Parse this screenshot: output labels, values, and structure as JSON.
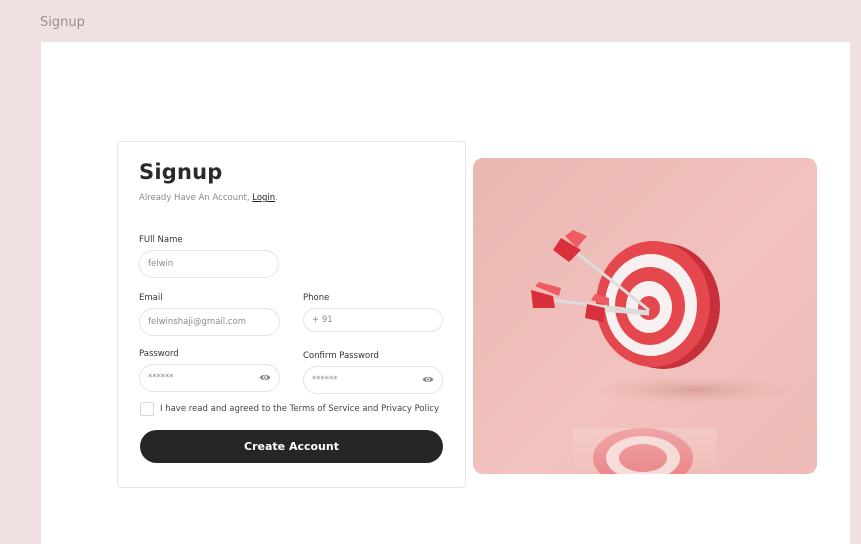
{
  "frame": {
    "label": "Signup"
  },
  "form": {
    "title": "Signup",
    "subtitle_prefix": "Already Have An Account, ",
    "login_link": "Login",
    "subtitle_suffix": ".",
    "fields": {
      "full_name": {
        "label": "FUll Name",
        "value": "felwin"
      },
      "email": {
        "label": "Email",
        "value": "felwinshaji@gmail.com"
      },
      "phone": {
        "label": "Phone",
        "value": "+ 91"
      },
      "password": {
        "label": "Password",
        "value": "******"
      },
      "confirm_password": {
        "label": "Confirm Password",
        "value": "******"
      }
    },
    "agree_text": "I have read and agreed to the Terms of Service and Privacy Policy",
    "submit_label": "Create Account"
  },
  "hero": {
    "image": "target-with-arrows-illustration"
  },
  "colors": {
    "page_bg": "#efe1e1",
    "button_bg": "#262626",
    "hero_bg": "#eebbb7",
    "target_red": "#e5474f"
  }
}
